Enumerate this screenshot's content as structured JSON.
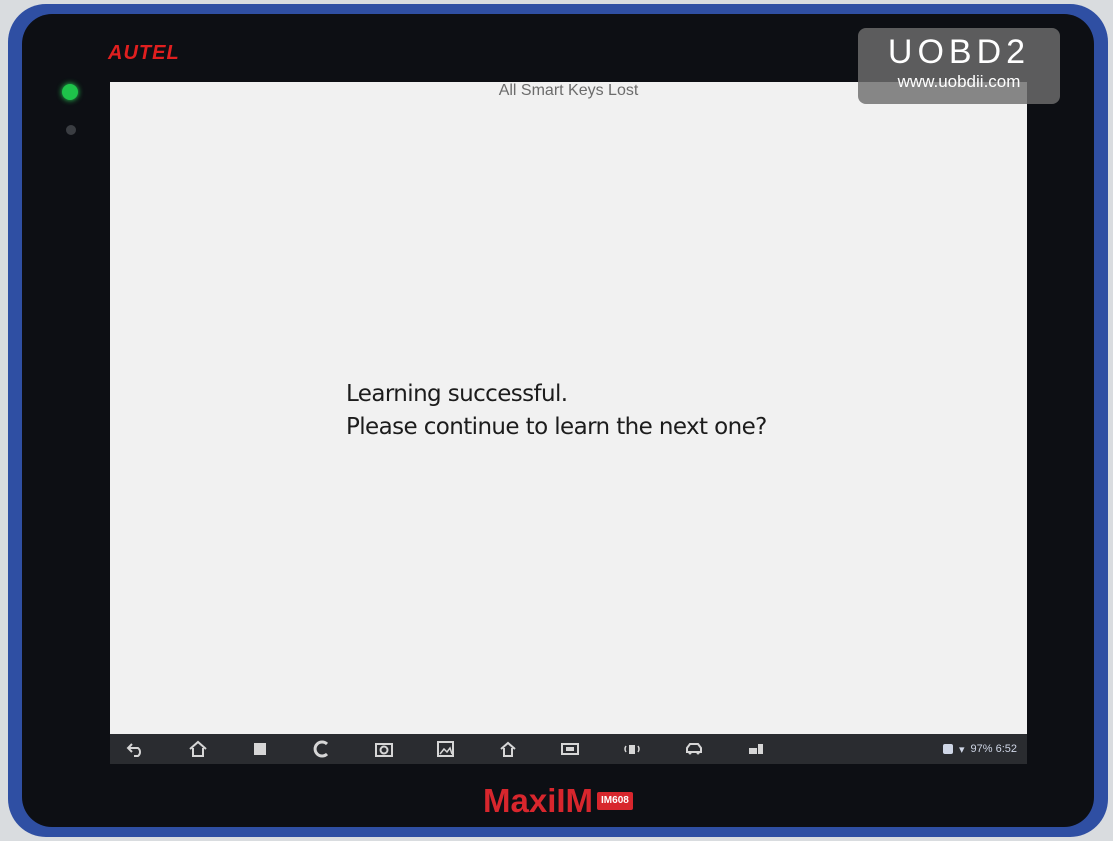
{
  "device": {
    "brand": "AUTEL",
    "model_name": "MaxiIM",
    "model_badge": "IM608"
  },
  "screen": {
    "title": "All Smart Keys Lost",
    "message_lines": [
      "Learning successful.",
      "Please continue to learn the next one?"
    ]
  },
  "navbar": {
    "icons": [
      "back-icon",
      "home-icon",
      "recent-apps-icon",
      "browser-icon",
      "camera-icon",
      "gallery-icon",
      "autel-home-icon",
      "vci-icon",
      "wifi-vci-icon",
      "vehicle-icon",
      "settings-icon"
    ],
    "status_text": "97% 6:52"
  },
  "watermark": {
    "title": "UOBD2",
    "url": "www.uobdii.com"
  },
  "colors": {
    "brand_red": "#e01f1f",
    "led_green": "#1ec34a",
    "frame_blue": "#2f4fa3"
  }
}
